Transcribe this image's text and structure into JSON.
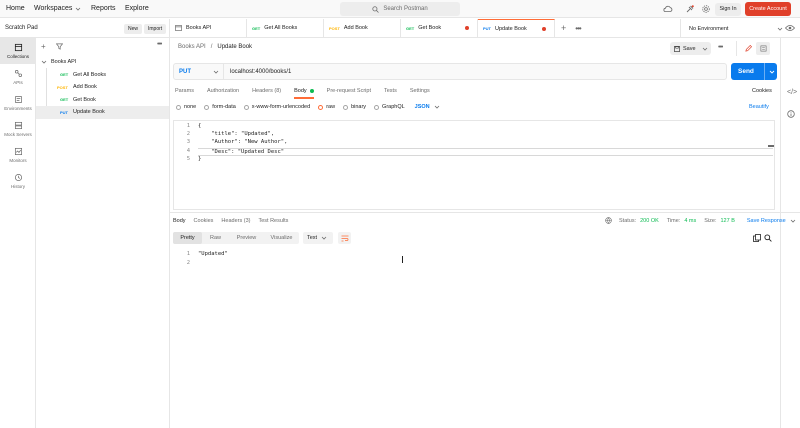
{
  "topbar": {
    "nav": [
      "Home",
      "Workspaces",
      "Reports",
      "Explore"
    ],
    "search_placeholder": "Search Postman",
    "sign_in": "Sign In",
    "create_account": "Create Account"
  },
  "sidebar": {
    "title": "Scratch Pad",
    "new_label": "New",
    "import_label": "Import",
    "rail": [
      {
        "label": "Collections",
        "icon": "collections-icon"
      },
      {
        "label": "APIs",
        "icon": "apis-icon"
      },
      {
        "label": "Environments",
        "icon": "environments-icon"
      },
      {
        "label": "Mock Servers",
        "icon": "mock-servers-icon"
      },
      {
        "label": "Monitors",
        "icon": "monitors-icon"
      },
      {
        "label": "History",
        "icon": "history-icon"
      }
    ],
    "collection": {
      "name": "Books API",
      "requests": [
        {
          "method": "GET",
          "name": "Get All Books"
        },
        {
          "method": "POST",
          "name": "Add Book"
        },
        {
          "method": "GET",
          "name": "Get Book"
        },
        {
          "method": "PUT",
          "name": "Update Book"
        }
      ]
    }
  },
  "tabs": [
    {
      "method": "",
      "name": "Books API"
    },
    {
      "method": "GET",
      "name": "Get All Books"
    },
    {
      "method": "POST",
      "name": "Add Book"
    },
    {
      "method": "GET",
      "name": "Get Book"
    },
    {
      "method": "PUT",
      "name": "Update Book"
    }
  ],
  "environment": "No Environment",
  "request": {
    "breadcrumb_parent": "Books API",
    "breadcrumb_current": "Update Book",
    "save_label": "Save",
    "method": "PUT",
    "url": "localhost:4000/books/1",
    "send_label": "Send",
    "subtabs": [
      "Params",
      "Authorization",
      "Headers (8)",
      "Body",
      "Pre-request Script",
      "Tests",
      "Settings"
    ],
    "cookies_label": "Cookies",
    "body_types": [
      "none",
      "form-data",
      "x-www-form-urlencoded",
      "raw",
      "binary",
      "GraphQL"
    ],
    "body_format": "JSON",
    "beautify_label": "Beautify",
    "body_lines": [
      "{",
      "    \"title\": \"Updated\",",
      "    \"Author\": \"New Author\",",
      "    \"Desc\": \"Updated Desc\"",
      "}"
    ],
    "line_numbers": [
      "1",
      "2",
      "3",
      "4",
      "5"
    ]
  },
  "response": {
    "tabs": [
      "Body",
      "Cookies",
      "Headers (3)",
      "Test Results"
    ],
    "status_label": "Status:",
    "status_value": "200 OK",
    "time_label": "Time:",
    "time_value": "4 ms",
    "size_label": "Size:",
    "size_value": "127 B",
    "save_response_label": "Save Response",
    "formats": [
      "Pretty",
      "Raw",
      "Preview",
      "Visualize"
    ],
    "text_select": "Text",
    "body_lines": [
      "\"Updated\"",
      ""
    ],
    "line_numbers": [
      "1",
      "2"
    ]
  },
  "colors": {
    "accent": "#ff6c37",
    "send": "#097bed",
    "get": "#0cbb52",
    "post": "#ffb400",
    "put": "#097bed",
    "create": "#e0402a"
  }
}
